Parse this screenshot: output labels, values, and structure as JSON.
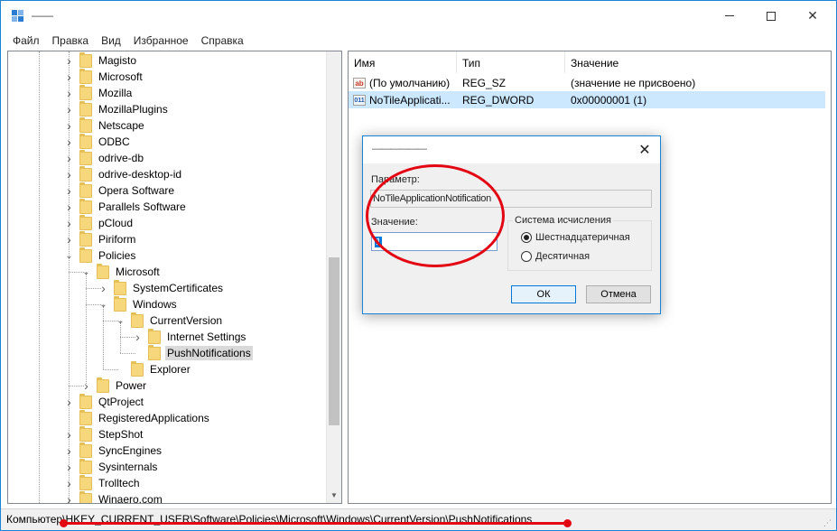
{
  "window": {
    "title": "——"
  },
  "menu": [
    "Файл",
    "Правка",
    "Вид",
    "Избранное",
    "Справка"
  ],
  "tree": {
    "items": [
      {
        "label": "Magisto",
        "level": 0,
        "chev": ">"
      },
      {
        "label": "Microsoft",
        "level": 0,
        "chev": ">"
      },
      {
        "label": "Mozilla",
        "level": 0,
        "chev": ">"
      },
      {
        "label": "MozillaPlugins",
        "level": 0,
        "chev": ">"
      },
      {
        "label": "Netscape",
        "level": 0,
        "chev": ">"
      },
      {
        "label": "ODBC",
        "level": 0,
        "chev": ">"
      },
      {
        "label": "odrive-db",
        "level": 0,
        "chev": ">"
      },
      {
        "label": "odrive-desktop-id",
        "level": 0,
        "chev": ">"
      },
      {
        "label": "Opera Software",
        "level": 0,
        "chev": ">"
      },
      {
        "label": "Parallels Software",
        "level": 0,
        "chev": ">"
      },
      {
        "label": "pCloud",
        "level": 0,
        "chev": ">"
      },
      {
        "label": "Piriform",
        "level": 0,
        "chev": ">"
      },
      {
        "label": "Policies",
        "level": 0,
        "chev": "v"
      },
      {
        "label": "Microsoft",
        "level": 1,
        "chev": "v"
      },
      {
        "label": "SystemCertificates",
        "level": 2,
        "chev": ">"
      },
      {
        "label": "Windows",
        "level": 2,
        "chev": "v"
      },
      {
        "label": "CurrentVersion",
        "level": 3,
        "chev": "v"
      },
      {
        "label": "Internet Settings",
        "level": 4,
        "chev": ">"
      },
      {
        "label": "PushNotifications",
        "level": 4,
        "chev": "",
        "selected": true
      },
      {
        "label": "Explorer",
        "level": 3,
        "chev": ""
      },
      {
        "label": "Power",
        "level": 1,
        "chev": ">"
      },
      {
        "label": "QtProject",
        "level": 0,
        "chev": ">"
      },
      {
        "label": "RegisteredApplications",
        "level": 0,
        "chev": ""
      },
      {
        "label": "StepShot",
        "level": 0,
        "chev": ">"
      },
      {
        "label": "SyncEngines",
        "level": 0,
        "chev": ">"
      },
      {
        "label": "Sysinternals",
        "level": 0,
        "chev": ">"
      },
      {
        "label": "Trolltech",
        "level": 0,
        "chev": ">"
      },
      {
        "label": "Winaero.com",
        "level": 0,
        "chev": ">"
      }
    ]
  },
  "list": {
    "columns": [
      "Имя",
      "Тип",
      "Значение"
    ],
    "rows": [
      {
        "icon": "ab",
        "name": "(По умолчанию)",
        "type": "REG_SZ",
        "value": "(значение не присвоено)",
        "selected": false
      },
      {
        "icon": "bin",
        "name": "NoTileApplicati...",
        "type": "REG_DWORD",
        "value": "0x00000001 (1)",
        "selected": true
      }
    ]
  },
  "dialog": {
    "title": "——————",
    "param_label": "Параметр:",
    "param_value": "NoTileApplicationNotification",
    "value_label": "Значение:",
    "value": "1",
    "base_group": "Система исчисления",
    "hex_label": "Шестнадцатеричная",
    "dec_label": "Десятичная",
    "ok": "ОК",
    "cancel": "Отмена"
  },
  "status": {
    "path": "Компьютер\\HKEY_CURRENT_USER\\Software\\Policies\\Microsoft\\Windows\\CurrentVersion\\PushNotifications"
  },
  "icons": {
    "regedit": "regedit-icon",
    "folder": "folder-icon",
    "string_value": "string-value-icon",
    "binary_value": "dword-value-icon"
  },
  "colors": {
    "accent": "#1883d7",
    "selection": "#cce8ff",
    "annotation": "#e30613",
    "folder": "#f7d77c"
  }
}
